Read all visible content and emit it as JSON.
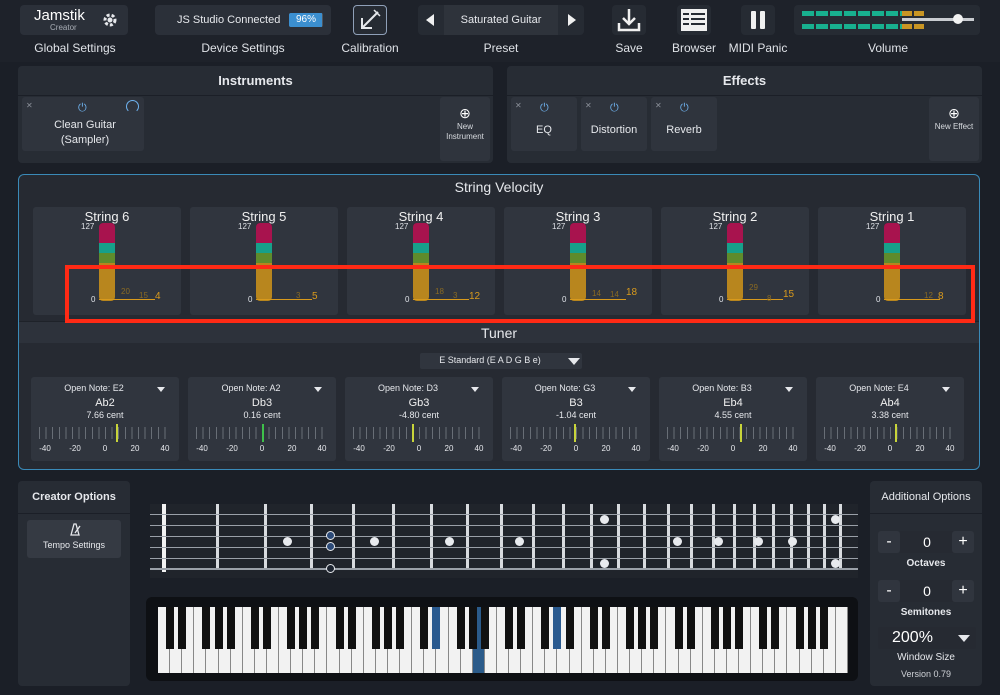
{
  "topbar": {
    "logo": "Jamstik",
    "logo_sub": "Creator",
    "global_settings_label": "Global Settings",
    "device_status": "JS Studio Connected",
    "battery": "96%",
    "battery_level": 0.96,
    "device_settings_label": "Device Settings",
    "calibration_label": "Calibration",
    "preset_name": "Saturated Guitar",
    "preset_label": "Preset",
    "save_label": "Save",
    "browser_label": "Browser",
    "midi_panic_label": "MIDI Panic",
    "volume_label": "Volume",
    "volume_level": 0.78
  },
  "instruments": {
    "title": "Instruments",
    "items": [
      {
        "label": "Clean Guitar (Sampler)"
      }
    ],
    "new_label": "New Instrument"
  },
  "effects": {
    "title": "Effects",
    "items": [
      {
        "label": "EQ"
      },
      {
        "label": "Distortion"
      },
      {
        "label": "Reverb"
      }
    ],
    "new_label": "New Effect"
  },
  "string_velocity": {
    "title": "String Velocity",
    "max": "127",
    "min": "0",
    "strings": [
      {
        "label": "String 6",
        "value": "4",
        "faint1": "20",
        "faint2": "15"
      },
      {
        "label": "String 5",
        "value": "5",
        "faint1": "",
        "faint2": "3"
      },
      {
        "label": "String 4",
        "value": "12",
        "faint1": "18",
        "faint2": "3"
      },
      {
        "label": "String 3",
        "value": "18",
        "faint1": "14",
        "faint2": "14"
      },
      {
        "label": "String 2",
        "value": "15",
        "faint1": "29",
        "faint2": "8"
      },
      {
        "label": "String 1",
        "value": "8",
        "faint1": "",
        "faint2": "12"
      }
    ]
  },
  "tuner": {
    "title": "Tuner",
    "tuning": "E Standard (E A D G B e)",
    "scale": [
      "-40",
      "-20",
      "0",
      "20",
      "40"
    ],
    "strings": [
      {
        "open": "Open Note: E2",
        "note": "Ab2",
        "cent": "7.66 cent",
        "offset": 7.66
      },
      {
        "open": "Open Note: A2",
        "note": "Db3",
        "cent": "0.16 cent",
        "offset": 0.16
      },
      {
        "open": "Open Note: D3",
        "note": "Gb3",
        "cent": "-4.80 cent",
        "offset": -4.8
      },
      {
        "open": "Open Note: G3",
        "note": "B3",
        "cent": "-1.04 cent",
        "offset": -1.04
      },
      {
        "open": "Open Note: B3",
        "note": "Eb4",
        "cent": "4.55 cent",
        "offset": 4.55
      },
      {
        "open": "Open Note: E4",
        "note": "Ab4",
        "cent": "3.38 cent",
        "offset": 3.38
      }
    ]
  },
  "creator_options": {
    "title": "Creator Options",
    "tempo_label": "Tempo Settings"
  },
  "additional_options": {
    "title": "Additional Options",
    "octaves_value": "0",
    "octaves_label": "Octaves",
    "semitones_value": "0",
    "semitones_label": "Semitones",
    "window_size": "200%",
    "window_size_label": "Window Size",
    "version": "Version 0.79"
  },
  "colors": {
    "accent": "#3a8ab8",
    "highlight": "#ff2a15",
    "velocity": "#d99a1c"
  }
}
